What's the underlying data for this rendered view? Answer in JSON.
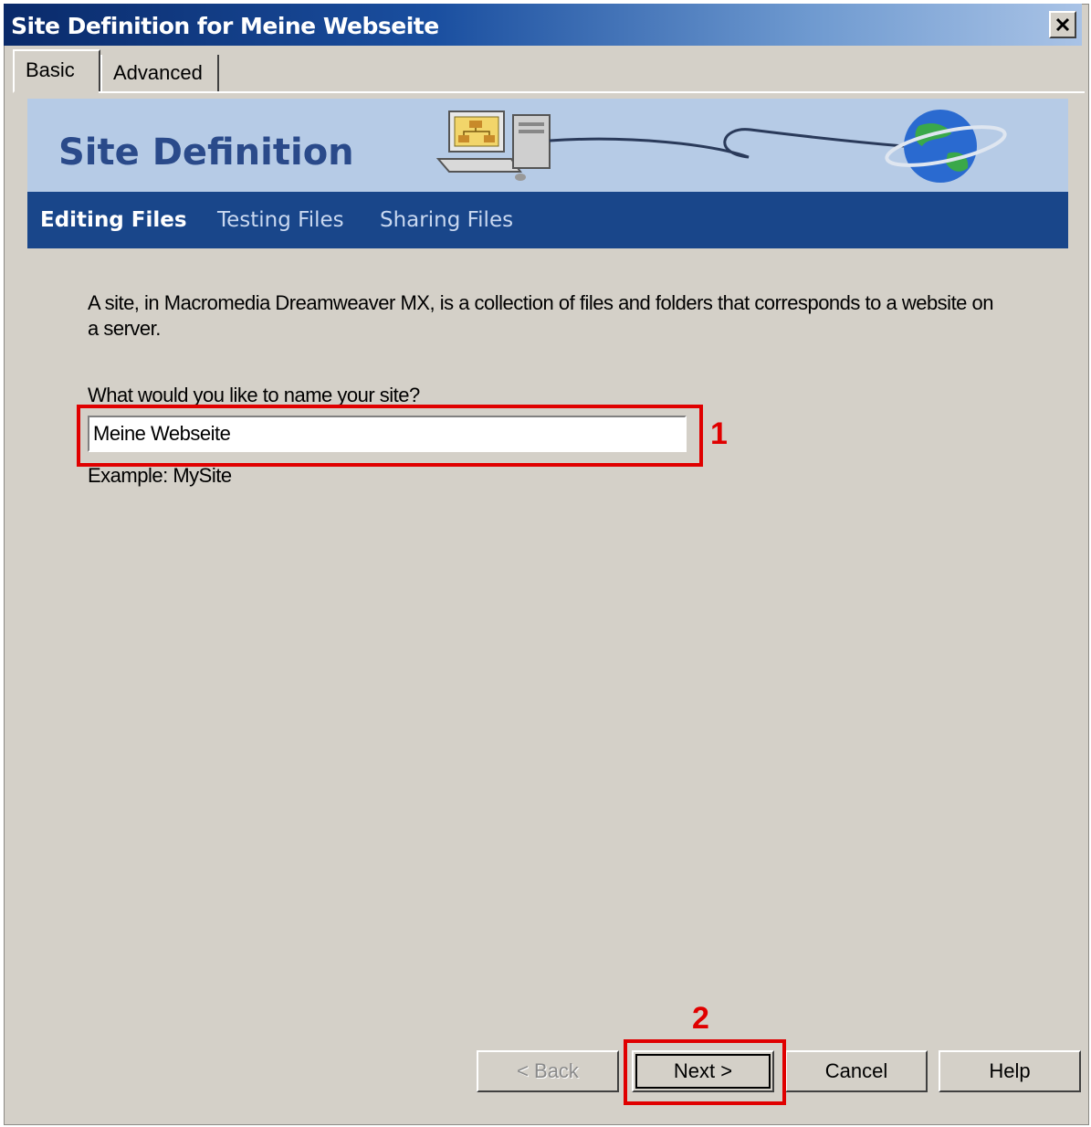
{
  "window": {
    "title": "Site Definition for Meine Webseite"
  },
  "tabs": [
    {
      "label": "Basic"
    },
    {
      "label": "Advanced"
    }
  ],
  "banner": {
    "title": "Site Definition"
  },
  "steps": [
    {
      "label": "Editing Files"
    },
    {
      "label": "Testing Files"
    },
    {
      "label": "Sharing Files"
    }
  ],
  "content": {
    "description": "A site, in Macromedia Dreamweaver MX, is a collection of files and folders that corresponds to a website on a server.",
    "question": "What would you like to name your site?",
    "site_name_value": "Meine Webseite",
    "example": "Example: MySite"
  },
  "annotations": [
    {
      "label": "1"
    },
    {
      "label": "2"
    }
  ],
  "buttons": {
    "back": "< Back",
    "next": "Next >",
    "cancel": "Cancel",
    "help": "Help"
  },
  "colors": {
    "dialog_bg": "#d4d0c8",
    "banner_bg": "#b6cbe6",
    "nav_bg": "#19468a",
    "annotation_red": "#e00000"
  }
}
